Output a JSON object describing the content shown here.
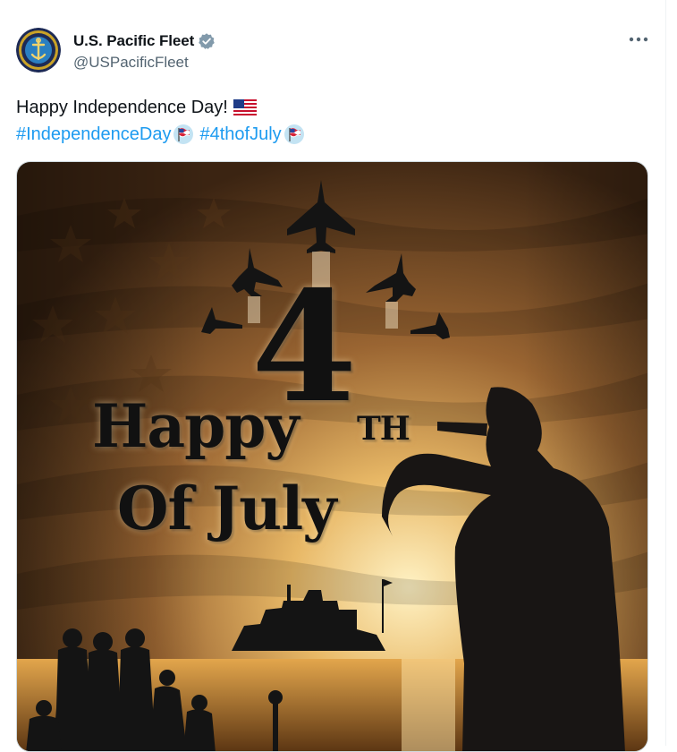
{
  "post": {
    "author_name": "U.S. Pacific Fleet",
    "author_handle": "@USPacificFleet",
    "verified_icon": "verified-badge-icon",
    "text_line1": "Happy Independence Day!",
    "hashtags": [
      "#IndependenceDay",
      "#4thofJuly"
    ],
    "more_icon": "more-options-icon"
  },
  "media": {
    "poster": {
      "line_happy": "Happy",
      "line_four": "4",
      "line_th": "TH",
      "line_july": "Of July"
    }
  },
  "colors": {
    "accent": "#1d9bf0",
    "secondary_text": "#536471",
    "primary_text": "#0f1419",
    "border": "#cfd9de"
  }
}
